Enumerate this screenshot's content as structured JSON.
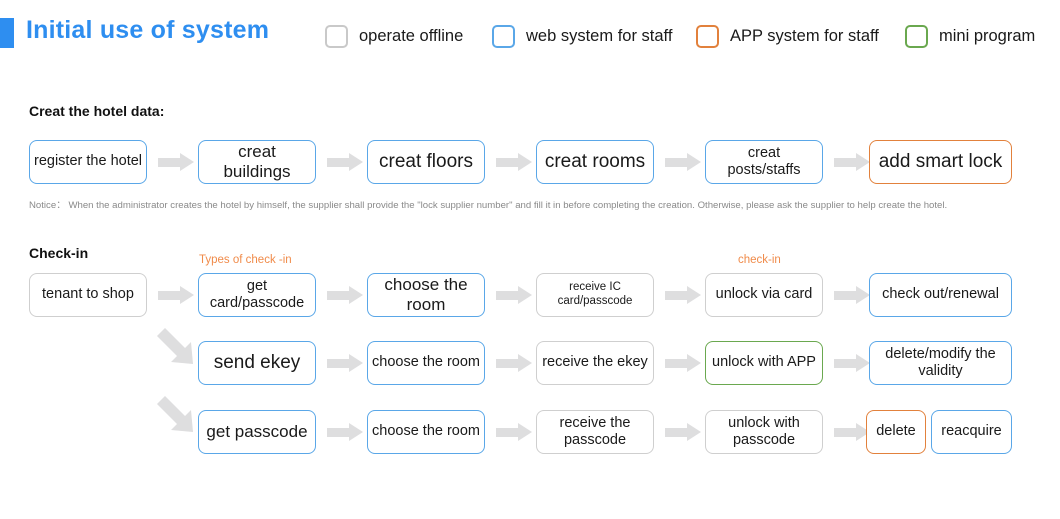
{
  "header": {
    "title": "Initial use of system",
    "accent_color": "#2e8ef0",
    "legend": [
      {
        "label": "operate offline",
        "color": "#c9c9c9",
        "icon": "square-outline-icon"
      },
      {
        "label": "web system for staff",
        "color": "#5aa7e8",
        "icon": "square-outline-icon"
      },
      {
        "label": "APP system for staff",
        "color": "#e2813c",
        "icon": "square-outline-icon"
      },
      {
        "label": "mini program",
        "color": "#6aa84f",
        "icon": "square-outline-icon"
      }
    ]
  },
  "sections": {
    "create_hotel": {
      "heading": "Creat the hotel data:",
      "notice": "Notice： When the administrator creates the hotel by himself, the supplier shall provide the \"lock supplier number\" and fill it in before completing the creation. Otherwise, please ask the supplier to help create the hotel."
    },
    "checkin": {
      "heading": "Check-in",
      "branch_label_types": "Types of check -in",
      "branch_label_checkin": "check-in"
    }
  },
  "flows": {
    "row1": [
      {
        "label": "register the hotel",
        "color": "blue",
        "size": "md"
      },
      {
        "label": "creat buildings",
        "color": "blue",
        "size": "lg"
      },
      {
        "label": "creat floors",
        "color": "blue",
        "size": "xl"
      },
      {
        "label": "creat rooms",
        "color": "blue",
        "size": "xl"
      },
      {
        "label": "creat posts/staffs",
        "color": "blue",
        "size": "md"
      },
      {
        "label": "add smart lock",
        "color": "orange",
        "size": "xl"
      }
    ],
    "row2": [
      {
        "label": "tenant to shop",
        "color": "gray",
        "size": "md"
      },
      {
        "label": "get card/passcode",
        "color": "blue",
        "size": "md"
      },
      {
        "label": "choose the room",
        "color": "blue",
        "size": "lg"
      },
      {
        "label": "receive IC card/passcode",
        "color": "gray",
        "size": "sm"
      },
      {
        "label": "unlock via card",
        "color": "gray",
        "size": "md"
      },
      {
        "label": "check out/renewal",
        "color": "blue",
        "size": "md"
      }
    ],
    "row3": [
      {
        "label": "send ekey",
        "color": "blue",
        "size": "xl"
      },
      {
        "label": "choose the room",
        "color": "blue",
        "size": "md"
      },
      {
        "label": "receive the ekey",
        "color": "gray",
        "size": "md"
      },
      {
        "label": "unlock with APP",
        "color": "green",
        "size": "md"
      },
      {
        "label": "delete/modify the validity",
        "color": "blue",
        "size": "md"
      }
    ],
    "row4": [
      {
        "label": "get passcode",
        "color": "blue",
        "size": "lg"
      },
      {
        "label": "choose the room",
        "color": "blue",
        "size": "md"
      },
      {
        "label": "receive the passcode",
        "color": "gray",
        "size": "md"
      },
      {
        "label": "unlock with passcode",
        "color": "gray",
        "size": "md"
      },
      {
        "label": "delete",
        "color": "orange",
        "size": "md"
      },
      {
        "label": "reacquire",
        "color": "blue",
        "size": "md"
      }
    ]
  }
}
